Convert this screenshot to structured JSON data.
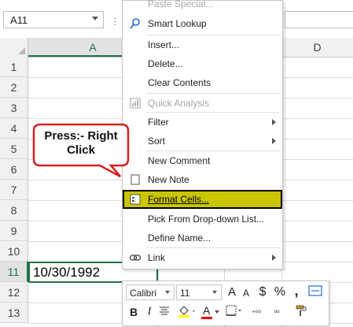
{
  "name_box": {
    "value": "A11"
  },
  "formula_bar": {
    "dots": "⋮"
  },
  "columns": [
    "A",
    "D"
  ],
  "rows": [
    "1",
    "2",
    "3",
    "4",
    "5",
    "6",
    "7",
    "8",
    "9",
    "10",
    "11",
    "12",
    "13"
  ],
  "cell": {
    "ref_row": "11",
    "value": "10/30/1992"
  },
  "context_menu": {
    "paste_special": "Paste Special...",
    "smart_lookup": "Smart Lookup",
    "insert": "Insert...",
    "delete": "Delete...",
    "clear_contents": "Clear Contents",
    "quick_analysis": "Quick Analysis",
    "filter": "Filter",
    "sort": "Sort",
    "new_comment": "New Comment",
    "new_note": "New Note",
    "format_cells": "Format Cells...",
    "pick_dropdown": "Pick From Drop-down List...",
    "define_name": "Define Name...",
    "link": "Link"
  },
  "callout": {
    "text_line1": "Press:- Right",
    "text_line2": "Click"
  },
  "mini_toolbar": {
    "font": "Calibri",
    "size": "11",
    "grow": "A",
    "shrink": "A",
    "currency": "$",
    "percent": "%",
    "comma": ",",
    "bold": "B",
    "italic": "I",
    "font_color": "A",
    "inc_decimal": "⁺⁰⁰",
    "dec_decimal": "⁰⁰"
  },
  "colors": {
    "excel_green": "#217346",
    "highlight": "#c9c500",
    "callout_border": "#d42020"
  }
}
